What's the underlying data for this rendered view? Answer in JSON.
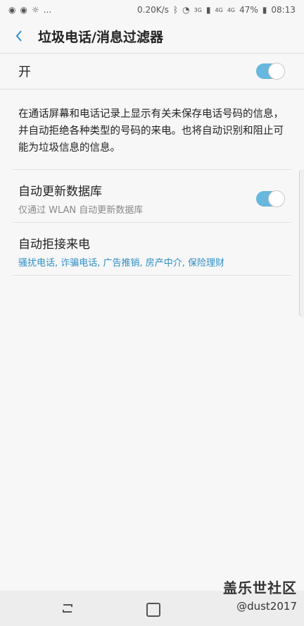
{
  "status_bar": {
    "left_icons": [
      "weibo-icon",
      "weibo-icon",
      "weather-icon",
      "more-dots"
    ],
    "dots": "...",
    "speed": "0.20K/s",
    "network_3g": "3G",
    "network_4g": "4G",
    "network_4g2": "4G",
    "battery": "47%",
    "time": "08:13"
  },
  "header": {
    "title": "垃圾电话/消息过滤器"
  },
  "master": {
    "label": "开",
    "enabled": true
  },
  "description": "在通话屏幕和电话记录上显示有关未保存电话号码的信息，并自动拒绝各种类型的号码的来电。也将自动识别和阻止可能为垃圾信息的信息。",
  "settings": [
    {
      "title": "自动更新数据库",
      "subtitle": "仅通过 WLAN 自动更新数据库",
      "enabled": true
    },
    {
      "title": "自动拒接来电",
      "subtitle": "骚扰电话, 诈骗电话, 广告推销, 房产中介, 保险理财"
    }
  ],
  "watermark": {
    "line1": "盖乐世社区",
    "line2": "@dust2017"
  },
  "colors": {
    "accent": "#67b7de",
    "link": "#2e8fc7",
    "background": "#f7f7f7"
  }
}
